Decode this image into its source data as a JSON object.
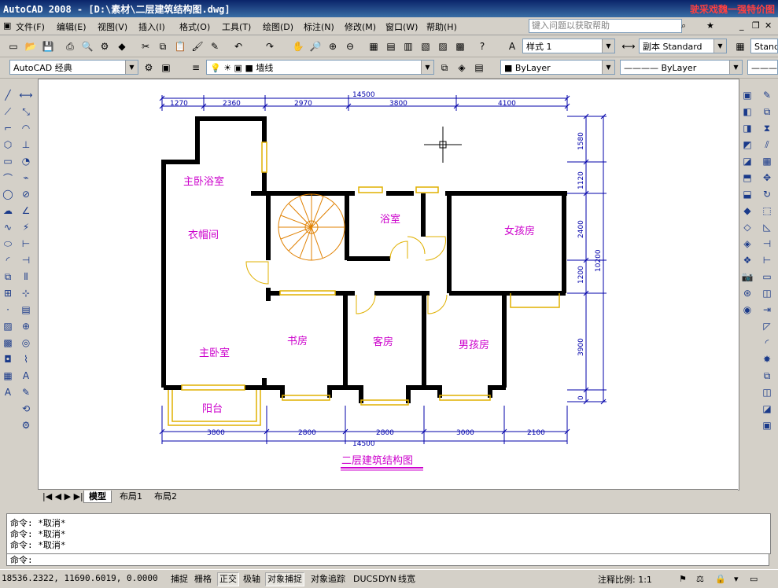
{
  "window": {
    "title": "AutoCAD 2008 - [D:\\素材\\二层建筑结构图.dwg]",
    "brand": "驶采戏魏一强特价图"
  },
  "menu": [
    "文件(F)",
    "编辑(E)",
    "视图(V)",
    "插入(I)",
    "格式(O)",
    "工具(T)",
    "绘图(D)",
    "标注(N)",
    "修改(M)",
    "窗口(W)",
    "帮助(H)"
  ],
  "help_placeholder": "键入问题以获取帮助",
  "toolbar": {
    "text_style": "样式 1",
    "dim_style": "副本 Standard",
    "table_style": "Stand",
    "workspace": "AutoCAD 经典",
    "layer": "墙线",
    "color": "ByLayer",
    "linetype": "ByLayer"
  },
  "drawing": {
    "title": "二层建筑结构图",
    "rooms": [
      "主卧浴室",
      "衣帽间",
      "浴室",
      "女孩房",
      "主卧室",
      "书房",
      "客房",
      "男孩房",
      "阳台"
    ],
    "top_total": "14500",
    "top_dims": [
      "1270",
      "2360",
      "2970",
      "3800",
      "4100"
    ],
    "bottom_dims": [
      "3800",
      "2800",
      "2800",
      "3000",
      "2100"
    ],
    "bottom_total": "14500",
    "right_dims": [
      "1580",
      "1120",
      "2400",
      "1200",
      "3900",
      "0"
    ],
    "right_total": "10200"
  },
  "tabs": [
    "模型",
    "布局1",
    "布局2"
  ],
  "command": {
    "history": [
      "命令: *取消*",
      "命令: *取消*",
      "命令: *取消*"
    ],
    "prompt": "命令:"
  },
  "status": {
    "coords": "18536.2322, 11690.6019, 0.0000",
    "buttons": [
      "捕捉",
      "栅格",
      "正交",
      "极轴",
      "对象捕捉",
      "对象追踪",
      "DUCS",
      "DYN",
      "线宽"
    ],
    "scale_label": "注释比例: 1:1"
  },
  "colors": {
    "wall": "#000000",
    "dim": "#0000aa",
    "room_label": "#cc00cc",
    "window": "#e0b000",
    "stair": "#e08000",
    "title_underline": "#cc00cc"
  }
}
